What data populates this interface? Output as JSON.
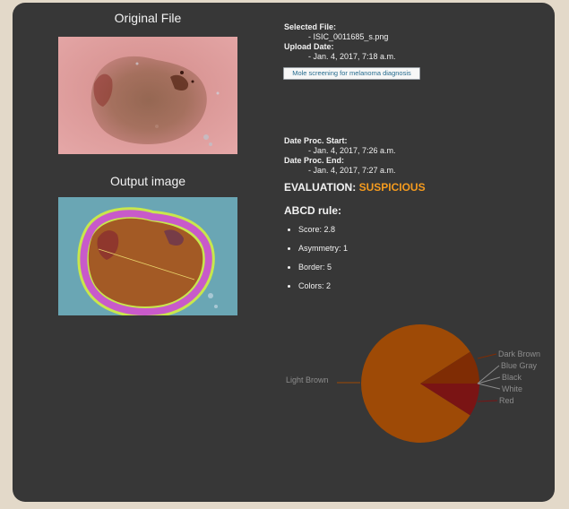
{
  "original_heading": "Original File",
  "output_heading": "Output image",
  "file_info": {
    "selected_label": "Selected File:",
    "selected_value": "- ISIC_0011685_s.png",
    "upload_label": "Upload Date:",
    "upload_value": "- Jan. 4, 2017, 7:18 a.m."
  },
  "diagnosis_button": "Mole screening for melanoma diagnosis",
  "processing": {
    "start_label": "Date Proc. Start:",
    "start_value": "- Jan. 4, 2017, 7:26 a.m.",
    "end_label": "Date Proc. End:",
    "end_value": "- Jan. 4, 2017, 7:27 a.m."
  },
  "evaluation": {
    "label": "EVALUATION:",
    "value": "SUSPICIOUS",
    "value_color": "#f59b1e"
  },
  "abcd": {
    "title": "ABCD rule:",
    "items": [
      "Score: 2.8",
      "Asymmetry: 1",
      "Border: 5",
      "Colors: 2"
    ]
  },
  "chart_data": {
    "type": "pie",
    "title": "",
    "slices": [
      {
        "label": "Light Brown",
        "value": 0.82,
        "color": "#9e4a06"
      },
      {
        "label": "Dark Brown",
        "value": 0.09,
        "color": "#7f2c04"
      },
      {
        "label": "Blue Gray",
        "value": 0.0,
        "color": "#7f2c04"
      },
      {
        "label": "Black",
        "value": 0.0,
        "color": "#7a1414"
      },
      {
        "label": "White",
        "value": 0.0,
        "color": "#7a1414"
      },
      {
        "label": "Red",
        "value": 0.09,
        "color": "#7a1414"
      }
    ]
  }
}
